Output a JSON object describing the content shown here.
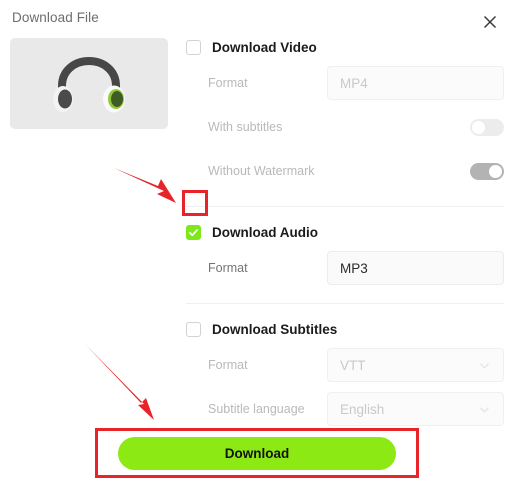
{
  "dialog": {
    "title": "Download File",
    "close_label": "×",
    "thumbnail_alt": "headphones-thumbnail"
  },
  "sections": {
    "video": {
      "label": "Download Video",
      "checked": false,
      "format_label": "Format",
      "format_value": "MP4",
      "with_subtitles_label": "With subtitles",
      "with_subtitles_on": false,
      "without_watermark_label": "Without Watermark",
      "without_watermark_on": true
    },
    "audio": {
      "label": "Download Audio",
      "checked": true,
      "format_label": "Format",
      "format_value": "MP3"
    },
    "subtitles": {
      "label": "Download Subtitles",
      "checked": false,
      "format_label": "Format",
      "format_value": "VTT",
      "language_label": "Subtitle language",
      "language_value": "English"
    }
  },
  "footer": {
    "download_label": "Download"
  },
  "colors": {
    "accent_green": "#8ce914",
    "checkbox_green": "#7ee81b",
    "annotation_red": "#e8232a",
    "title_gray": "#6d6d6d",
    "disabled_gray": "#b9b9b9"
  },
  "icons": {
    "close": "close-icon",
    "check": "check-icon",
    "chevron": "chevron-down-icon"
  }
}
